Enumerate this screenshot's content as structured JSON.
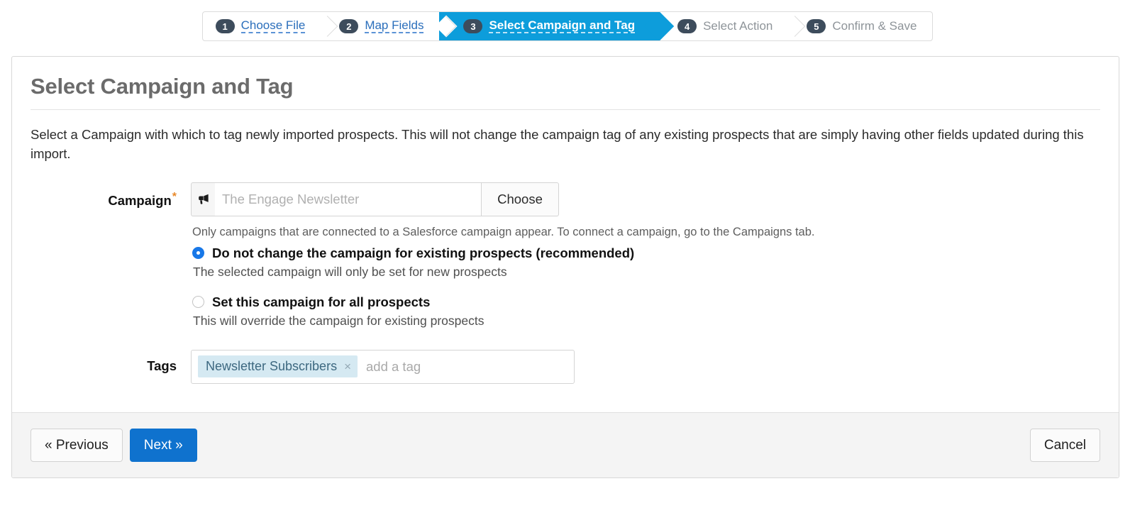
{
  "wizard": {
    "steps": [
      {
        "number": "1",
        "label": "Choose File",
        "state": "done"
      },
      {
        "number": "2",
        "label": "Map Fields",
        "state": "done"
      },
      {
        "number": "3",
        "label": "Select Campaign and Tag",
        "state": "active"
      },
      {
        "number": "4",
        "label": "Select Action",
        "state": "todo"
      },
      {
        "number": "5",
        "label": "Confirm & Save",
        "state": "todo"
      }
    ],
    "active_color": "#0d9ddb",
    "badge_color": "#3d4c5c",
    "link_color": "#2a6ebb"
  },
  "page": {
    "title": "Select Campaign and Tag",
    "intro": "Select a Campaign with which to tag newly imported prospects. This will not change the campaign tag of any existing prospects that are simply having other fields updated during this import."
  },
  "campaign": {
    "label": "Campaign",
    "required_mark": "*",
    "required_color": "#e8892b",
    "icon": "megaphone-icon",
    "value": "",
    "placeholder": "The Engage Newsletter",
    "choose_label": "Choose",
    "help_text": "Only campaigns that are connected to a Salesforce campaign appear. To connect a campaign, go to the Campaigns tab.",
    "options": [
      {
        "id": "do-not-change",
        "label": "Do not change the campaign for existing prospects (recommended)",
        "sub": "The selected campaign will only be set for new prospects",
        "checked": true
      },
      {
        "id": "set-all",
        "label": "Set this campaign for all prospects",
        "sub": "This will override the campaign for existing prospects",
        "checked": false
      }
    ],
    "radio_accent": "#1878e8"
  },
  "tags": {
    "label": "Tags",
    "chips": [
      {
        "text": "Newsletter Subscribers",
        "remove": "×"
      }
    ],
    "placeholder": "add a tag",
    "value": "",
    "chip_bg": "#d5e9f2",
    "chip_color": "#3d6880"
  },
  "footer": {
    "previous_label": "« Previous",
    "next_label": "Next »",
    "cancel_label": "Cancel",
    "primary_color": "#0f72ce"
  }
}
